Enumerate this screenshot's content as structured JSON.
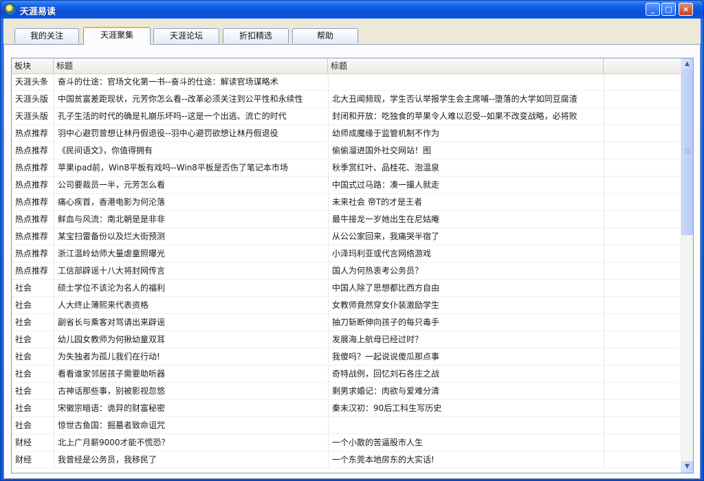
{
  "window": {
    "title": "天涯易读",
    "min_label": "_",
    "max_label": "□",
    "close_label": "×"
  },
  "tabs": [
    {
      "label": "我的关注",
      "active": false
    },
    {
      "label": "天涯聚集",
      "active": true
    },
    {
      "label": "天涯论坛",
      "active": false
    },
    {
      "label": "折扣精选",
      "active": false
    },
    {
      "label": "帮助",
      "active": false
    }
  ],
  "table": {
    "headers": [
      "板块",
      "标题",
      "标题",
      ""
    ],
    "rows": [
      [
        "天涯头条",
        "奋斗的仕途：官场文化第一书--奋斗的仕途：解读官场谋略术",
        ""
      ],
      [
        "天涯头版",
        "中国贫富差距现状，元芳你怎么看--改革必须关注到公平性和永续性",
        "北大丑闻频现，学生否认举报学生会主席哺--堕落的大学如同豆腐渣"
      ],
      [
        "天涯头版",
        "孔子生活的时代的确是礼崩乐坏吗--这是一个出逃、流亡的时代",
        "封闭和开放：吃独食的苹果令人难以忍受--如果不改变战略，必将败"
      ],
      [
        "热点推荐",
        "羽中心避罚曾想让林丹假退役--羽中心避罚欲想让林丹假退役",
        "幼师成魔缘于监管机制不作为"
      ],
      [
        "热点推荐",
        "《民间语文》，你值得拥有",
        "偷偷溜进国外社交网站！图"
      ],
      [
        "热点推荐",
        "苹果ipad前，Win8平板有戏吗--Win8平板是否伤了笔记本市场",
        "秋季赏红叶、品桂花、泡温泉"
      ],
      [
        "热点推荐",
        "公司要裁员一半，元芳怎么看",
        "中国式过马路：凑一撮人就走"
      ],
      [
        "热点推荐",
        "痛心疾首，香港电影为何沦落",
        "未来社会 帝T的才是王者"
      ],
      [
        "热点推荐",
        "鲜血与风流：南北朝是是非非",
        "最牛接龙一岁她出生在尼姑庵"
      ],
      [
        "热点推荐",
        "某宝扫雷备份以及烂大街预测",
        "从公公家回来，我痛哭半宿了"
      ],
      [
        "热点推荐",
        "浙江温岭幼师大量虐童照曝光",
        "小泽玛利亚或代言网络游戏"
      ],
      [
        "热点推荐",
        "工信部辟谣十八大将封网传言",
        "国人为何热衷考公务员？"
      ],
      [
        "社会",
        "硕士学位不该沦为名人的福利",
        "中国人除了思想都比西方自由"
      ],
      [
        "社会",
        "人大终止薄熙来代表资格",
        "女教师竟然穿女仆装激励学生"
      ],
      [
        "社会",
        "副省长与乘客对骂请出来辟谣",
        "抽刀斩断伸向孩子的每只毒手"
      ],
      [
        "社会",
        "幼儿园女教师为何揪幼童双耳",
        "发展海上航母已经过时？"
      ],
      [
        "社会",
        "为失独者为孤儿我们在行动!",
        "我傻吗？一起说说傻瓜那点事"
      ],
      [
        "社会",
        "看看谁家邻居孩子需要助听器",
        "奇特战例，回忆刘石各庄之战"
      ],
      [
        "社会",
        "古神话那些事，别被影视忽悠",
        "剩男求婚记：肉欲与爱难分清"
      ],
      [
        "社会",
        "宋徽宗暗语：诡异的财富秘密",
        "秦末汉初：90后工科生写历史"
      ],
      [
        "社会",
        "惊世古鱼国：掘墓者致命诅咒",
        ""
      ],
      [
        "财经",
        "北上广月薪9000才能不慌恐？",
        "一个小散的苦逼股市人生"
      ],
      [
        "财经",
        "我曾经是公务员，我移民了",
        "一个东莞本地房东的大实话!"
      ]
    ]
  },
  "icons": {
    "app": "globe-app-icon",
    "scroll_up": "scroll-up-arrow-icon",
    "scroll_down": "scroll-down-arrow-icon",
    "grip": "scroll-grip-icon"
  },
  "colors": {
    "titlebar": "#0a4fd6",
    "client_bg": "#ece9d8",
    "active_tab_accent": "#f4b23c"
  }
}
